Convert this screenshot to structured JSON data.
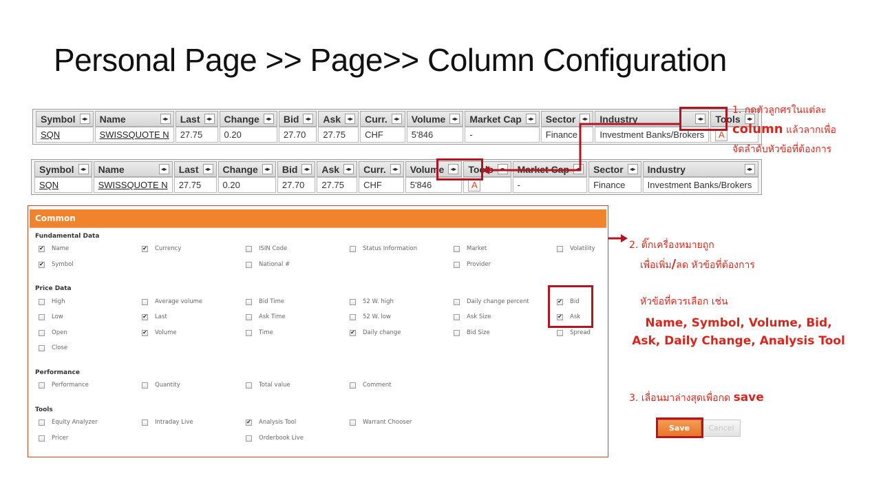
{
  "title": "Personal Page >> Page>> Column Configuration",
  "table1": {
    "headers": [
      "Symbol",
      "Name",
      "Last",
      "Change",
      "Bid",
      "Ask",
      "Curr.",
      "Volume",
      "Market Cap",
      "Sector",
      "Industry",
      "Tools"
    ],
    "row": [
      "SQN",
      "SWISSQUOTE N",
      "27.75",
      "0.20",
      "27.70",
      "27.75",
      "CHF",
      "5'846",
      "-",
      "Finance",
      "Investment Banks/Brokers",
      "A"
    ]
  },
  "table2": {
    "headers": [
      "Symbol",
      "Name",
      "Last",
      "Change",
      "Bid",
      "Ask",
      "Curr.",
      "Volume",
      "Tools",
      "Market Cap",
      "Sector",
      "Industry"
    ],
    "row": [
      "SQN",
      "SWISSQUOTE N",
      "27.75",
      "0.20",
      "27.70",
      "27.75",
      "CHF",
      "5'846",
      "A",
      "-",
      "Finance",
      "Investment Banks/Brokers"
    ]
  },
  "annotations": {
    "note1_line1": "1. กดตัวลูกศรในแต่ละ",
    "note1_bold": "column",
    "note1_line2_rest": " แล้วลากเพื่อ",
    "note1_line3": "จัดลำดับหัวข้อที่ต้องการ",
    "note2_line1": "2. ติ๊กเครื่องหมายถูก",
    "note2_line2a": "เพื่อเพิ่ม",
    "note2_line2_bold": "/",
    "note2_line2b": "ลด  หัวข้อที่ต้องการ",
    "note3_line1": "หัวข้อที่ควรเลือก เช่น",
    "note3_line2": "Name, Symbol, Volume, Bid,",
    "note3_line3": "Ask, Daily Change, Analysis Tool",
    "note4_text": "3. เลื่อนมาล่างสุดเพื่อกด ",
    "note4_bold": "save"
  },
  "panel": {
    "header": "Common",
    "groups": {
      "fundamental": "Fundamental Data",
      "price": "Price Data",
      "performance": "Performance",
      "tools": "Tools"
    },
    "options": {
      "name": {
        "label": "Name",
        "checked": true
      },
      "currency": {
        "label": "Currency",
        "checked": true
      },
      "isin": {
        "label": "ISIN Code",
        "checked": false
      },
      "status_info": {
        "label": "Status Information",
        "checked": false
      },
      "market": {
        "label": "Market",
        "checked": false
      },
      "volatility": {
        "label": "Volatility",
        "checked": false
      },
      "symbol": {
        "label": "Symbol",
        "checked": true
      },
      "national": {
        "label": "National #",
        "checked": false
      },
      "provider": {
        "label": "Provider",
        "checked": false
      },
      "high": {
        "label": "High",
        "checked": false
      },
      "avg_volume": {
        "label": "Average volume",
        "checked": false
      },
      "bid_time": {
        "label": "Bid Time",
        "checked": false
      },
      "w52_high": {
        "label": "52 W. high",
        "checked": false
      },
      "daily_change_pct": {
        "label": "Daily change percent",
        "checked": false
      },
      "bid": {
        "label": "Bid",
        "checked": true
      },
      "low": {
        "label": "Low",
        "checked": false
      },
      "last": {
        "label": "Last",
        "checked": true
      },
      "ask_time": {
        "label": "Ask Time",
        "checked": false
      },
      "w52_low": {
        "label": "52 W. low",
        "checked": false
      },
      "ask_size": {
        "label": "Ask Size",
        "checked": false
      },
      "ask": {
        "label": "Ask",
        "checked": true
      },
      "open": {
        "label": "Open",
        "checked": false
      },
      "volume": {
        "label": "Volume",
        "checked": true
      },
      "time": {
        "label": "Time",
        "checked": false
      },
      "daily_change": {
        "label": "Daily change",
        "checked": true
      },
      "bid_size": {
        "label": "Bid Size",
        "checked": false
      },
      "spread": {
        "label": "Spread",
        "checked": false
      },
      "close": {
        "label": "Close",
        "checked": false
      },
      "performance": {
        "label": "Performance",
        "checked": false
      },
      "quantity": {
        "label": "Quantity",
        "checked": false
      },
      "total_value": {
        "label": "Total value",
        "checked": false
      },
      "comment": {
        "label": "Comment",
        "checked": false
      },
      "equity_analyzer": {
        "label": "Equity Analyzer",
        "checked": false
      },
      "intraday_live": {
        "label": "Intraday Live",
        "checked": false
      },
      "analysis_tool": {
        "label": "Analysis Tool",
        "checked": true
      },
      "warrant_chooser": {
        "label": "Warrant Chooser",
        "checked": false
      },
      "pricer": {
        "label": "Pricer",
        "checked": false
      },
      "orderbook_live": {
        "label": "Orderbook Live",
        "checked": false
      }
    }
  },
  "buttons": {
    "save": "Save",
    "cancel": "Cancel"
  },
  "colors": {
    "accent_red": "#d9261c",
    "box_red": "#b3141f",
    "panel_orange": "#f0832b"
  }
}
